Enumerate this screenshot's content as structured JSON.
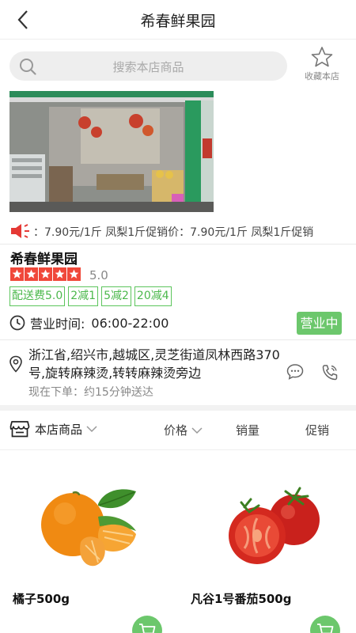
{
  "header": {
    "title": "希春鲜果园"
  },
  "search": {
    "placeholder": "搜索本店商品",
    "fav_label": "收藏本店"
  },
  "announcement": {
    "text": "：7.90元/1斤    凤梨1斤促销价：7.90元/1斤    凤梨1斤促销"
  },
  "store": {
    "name": "希春鲜果园",
    "rating": "5.0",
    "tags": [
      "配送费5.0",
      "2减1",
      "5减2",
      "20减4"
    ],
    "hours_label": "营业时间:",
    "hours_value": "06:00-22:00",
    "status": "营业中",
    "address": "浙江省,绍兴市,越城区,灵芝街道凤林西路370号,旋转麻辣烫,转转麻辣烫旁边",
    "eta": "现在下单：约15分钟送达"
  },
  "tabs": {
    "store_goods": "本店商品",
    "price": "价格",
    "sales": "销量",
    "promo": "促销"
  },
  "products": [
    {
      "name": "橘子500g"
    },
    {
      "name": "凡谷1号番茄500g"
    }
  ],
  "colors": {
    "accent_green": "#6cc76c",
    "star_red": "#f0483a",
    "announce_red": "#e53935"
  }
}
